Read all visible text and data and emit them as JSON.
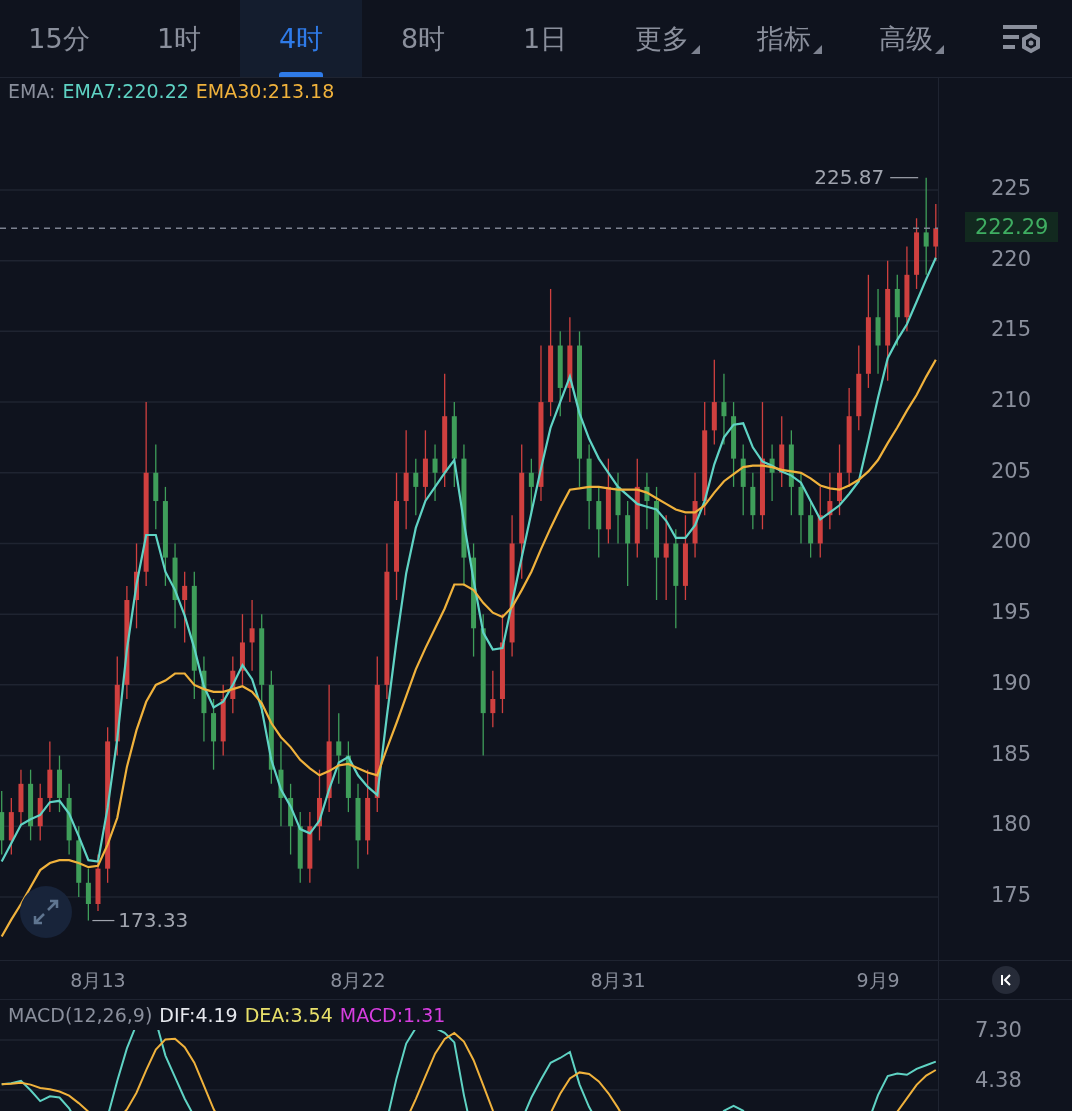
{
  "tabs": [
    {
      "label": "15分",
      "selected": false,
      "dropdown": false
    },
    {
      "label": "1时",
      "selected": false,
      "dropdown": false
    },
    {
      "label": "4时",
      "selected": true,
      "dropdown": false
    },
    {
      "label": "8时",
      "selected": false,
      "dropdown": false
    },
    {
      "label": "1日",
      "selected": false,
      "dropdown": false
    },
    {
      "label": "更多",
      "selected": false,
      "dropdown": true
    },
    {
      "label": "指标",
      "selected": false,
      "dropdown": true
    },
    {
      "label": "高级",
      "selected": false,
      "dropdown": true
    }
  ],
  "price_chart": {
    "legend_name": "EMA:",
    "legend": [
      ":220.22",
      ":213.18"
    ],
    "chart_data": {
      "type": "candlestick",
      "categories": [
        null,
        null,
        null,
        null,
        null,
        null,
        null,
        null,
        null,
        null,
        "8月13",
        null,
        null,
        null,
        null,
        null,
        null,
        null,
        null,
        null,
        null,
        null,
        null,
        null,
        null,
        null,
        null,
        null,
        null,
        null,
        null,
        null,
        null,
        null,
        null,
        null,
        null,
        "8月22",
        null,
        null,
        null,
        null,
        null,
        null,
        null,
        null,
        null,
        null,
        null,
        null,
        null,
        null,
        null,
        null,
        null,
        null,
        null,
        null,
        null,
        null,
        null,
        null,
        null,
        null,
        "8月31",
        null,
        null,
        null,
        null,
        null,
        null,
        null,
        null,
        null,
        null,
        null,
        null,
        null,
        null,
        null,
        null,
        null,
        null,
        null,
        null,
        null,
        null,
        null,
        null,
        null,
        null,
        "9月9",
        null,
        null,
        null,
        null,
        null,
        null
      ],
      "ohlc": [
        [
          181,
          182.5,
          178,
          179
        ],
        [
          179,
          182,
          178,
          181
        ],
        [
          181,
          184,
          180,
          183
        ],
        [
          183,
          184,
          179,
          180
        ],
        [
          180,
          183,
          179,
          182
        ],
        [
          182,
          186,
          181,
          184
        ],
        [
          184,
          185,
          181,
          182
        ],
        [
          182,
          183,
          178,
          179
        ],
        [
          179,
          180,
          175,
          176
        ],
        [
          176,
          177,
          173.33,
          174.5
        ],
        [
          174.5,
          178,
          174,
          177
        ],
        [
          177,
          187,
          176,
          186
        ],
        [
          186,
          192,
          185,
          190
        ],
        [
          190,
          197,
          189,
          196
        ],
        [
          196,
          200,
          194,
          198
        ],
        [
          198,
          210,
          197,
          205
        ],
        [
          205,
          207,
          201,
          203
        ],
        [
          203,
          204,
          197,
          199
        ],
        [
          199,
          200,
          194,
          196
        ],
        [
          196,
          198,
          193,
          197
        ],
        [
          197,
          198,
          189,
          191
        ],
        [
          191,
          192,
          186,
          188
        ],
        [
          188,
          189,
          184,
          186
        ],
        [
          186,
          190,
          185,
          189
        ],
        [
          189,
          192,
          188,
          191
        ],
        [
          191,
          195,
          190,
          193
        ],
        [
          193,
          196,
          191,
          194
        ],
        [
          194,
          195,
          188,
          190
        ],
        [
          190,
          191,
          183,
          184
        ],
        [
          184,
          186,
          180,
          182
        ],
        [
          182,
          183,
          178,
          180
        ],
        [
          180,
          181,
          176,
          177
        ],
        [
          177,
          181,
          176,
          180
        ],
        [
          180,
          184,
          179,
          182
        ],
        [
          182,
          190,
          181,
          186
        ],
        [
          186,
          188,
          183,
          185
        ],
        [
          185,
          186,
          181,
          182
        ],
        [
          182,
          183,
          177,
          179
        ],
        [
          179,
          184,
          178,
          182
        ],
        [
          182,
          192,
          181,
          190
        ],
        [
          190,
          200,
          189,
          198
        ],
        [
          198,
          205,
          196,
          203
        ],
        [
          203,
          208,
          201,
          205
        ],
        [
          205,
          206,
          202,
          204
        ],
        [
          204,
          208,
          203,
          206
        ],
        [
          206,
          207,
          203,
          205
        ],
        [
          205,
          212,
          204,
          209
        ],
        [
          209,
          210,
          204,
          206
        ],
        [
          206,
          207,
          197,
          199
        ],
        [
          199,
          200,
          192,
          194
        ],
        [
          194,
          195,
          185,
          188
        ],
        [
          188,
          191,
          187,
          189
        ],
        [
          189,
          195,
          188,
          193
        ],
        [
          193,
          202,
          192,
          200
        ],
        [
          200,
          207,
          197.5,
          205
        ],
        [
          205,
          206,
          202,
          204
        ],
        [
          204,
          214,
          203,
          210
        ],
        [
          210,
          218,
          209,
          214
        ],
        [
          214,
          215,
          209,
          211
        ],
        [
          211,
          216,
          210,
          214
        ],
        [
          214,
          215,
          204,
          206
        ],
        [
          206,
          207,
          201,
          203
        ],
        [
          203,
          204,
          199,
          201
        ],
        [
          201,
          206,
          200,
          204
        ],
        [
          204,
          205,
          200,
          202
        ],
        [
          202,
          203,
          197,
          200
        ],
        [
          200,
          206,
          199,
          204
        ],
        [
          204,
          205,
          201,
          203
        ],
        [
          203,
          204,
          196,
          199
        ],
        [
          199,
          202,
          196,
          200
        ],
        [
          200,
          201,
          194,
          197
        ],
        [
          197,
          202,
          196,
          200
        ],
        [
          200,
          205,
          199,
          203
        ],
        [
          203,
          210,
          202,
          208
        ],
        [
          208,
          213,
          207,
          210
        ],
        [
          210,
          212,
          207,
          209
        ],
        [
          209,
          210,
          204,
          206
        ],
        [
          206,
          207,
          202,
          204
        ],
        [
          204,
          205,
          201,
          202
        ],
        [
          202,
          210,
          201,
          206
        ],
        [
          206,
          207,
          203,
          205
        ],
        [
          205,
          209,
          204,
          207
        ],
        [
          207,
          208,
          202,
          204
        ],
        [
          204,
          205,
          200,
          202
        ],
        [
          202,
          203,
          199,
          200
        ],
        [
          200,
          204,
          199,
          202
        ],
        [
          202,
          205,
          201,
          203
        ],
        [
          203,
          207,
          202,
          205
        ],
        [
          205,
          211,
          204,
          209
        ],
        [
          209,
          214,
          208,
          212
        ],
        [
          212,
          219,
          211,
          216
        ],
        [
          216,
          218,
          212,
          214
        ],
        [
          214,
          220,
          211.5,
          218
        ],
        [
          218,
          219,
          214,
          216
        ],
        [
          216,
          221,
          215,
          219
        ],
        [
          219,
          223,
          218,
          222
        ],
        [
          222,
          225.87,
          219,
          221
        ],
        [
          221,
          224,
          220,
          222.29
        ]
      ],
      "grid": true,
      "series": [
        {
          "name": "EMA7",
          "type": "line",
          "color": "#5fd3c4",
          "values": [
            177.5,
            178.8,
            180.1,
            180.5,
            180.8,
            181.7,
            181.8,
            180.9,
            179.3,
            177.6,
            177.5,
            181.3,
            186.2,
            192.5,
            197.1,
            200.6,
            200.6,
            198.0,
            196.7,
            194.9,
            192.6,
            189.9,
            188.4,
            188.8,
            190.0,
            191.4,
            190.4,
            188.3,
            184.7,
            182.6,
            181.4,
            179.8,
            179.5,
            180.4,
            182.6,
            184.5,
            184.9,
            183.6,
            182.8,
            182.2,
            187.8,
            193.1,
            197.9,
            201.1,
            203.0,
            204.0,
            205.0,
            205.9,
            201.5,
            197.4,
            193.7,
            192.5,
            192.6,
            195.8,
            199.0,
            202.2,
            205.3,
            208.2,
            210.0,
            211.8,
            209.2,
            207.4,
            206.0,
            205.0,
            204.0,
            203.4,
            202.8,
            202.6,
            202.4,
            201.6,
            200.4,
            200.4,
            201.3,
            203.0,
            205.6,
            207.5,
            208.4,
            208.5,
            206.8,
            205.8,
            205.5,
            205.1,
            204.8,
            204.3,
            203.0,
            201.7,
            202.2,
            202.7,
            203.5,
            204.4,
            207.3,
            210.3,
            213.1,
            214.4,
            215.5,
            217.1,
            218.7,
            220.2
          ]
        },
        {
          "name": "EMA30",
          "type": "line",
          "color": "#f0b23c",
          "values": [
            172.2,
            173.4,
            174.5,
            175.7,
            176.9,
            177.4,
            177.6,
            177.6,
            177.4,
            177.1,
            177.2,
            178.7,
            180.6,
            184.2,
            186.8,
            188.8,
            190.0,
            190.3,
            190.8,
            190.8,
            190.0,
            189.7,
            189.5,
            189.5,
            189.7,
            189.9,
            189.5,
            188.7,
            187.3,
            186.3,
            185.6,
            184.7,
            184.1,
            183.6,
            183.9,
            184.3,
            184.4,
            184.1,
            183.8,
            183.6,
            185.5,
            187.3,
            189.2,
            191.1,
            192.6,
            194.0,
            195.4,
            197.1,
            197.1,
            196.7,
            195.8,
            195.1,
            194.8,
            195.5,
            196.7,
            198.0,
            199.6,
            201.1,
            202.5,
            203.8,
            203.9,
            204.0,
            204.0,
            203.9,
            203.8,
            203.8,
            203.8,
            203.6,
            203.2,
            202.8,
            202.4,
            202.2,
            202.2,
            202.7,
            203.6,
            204.4,
            204.9,
            205.4,
            205.5,
            205.5,
            205.4,
            205.2,
            205.1,
            205.0,
            204.6,
            204.1,
            203.9,
            203.8,
            204.1,
            204.5,
            205.1,
            205.9,
            207.1,
            208.2,
            209.4,
            210.5,
            211.8,
            213.0
          ]
        }
      ],
      "ylim": [
        170.54,
        232.92
      ],
      "yticks": [
        175,
        180,
        185,
        190,
        195,
        200,
        205,
        210,
        215,
        220,
        225
      ],
      "ref_lines": [
        {
          "axis": "y",
          "value": 222.29,
          "label": "222.29"
        }
      ],
      "annotations": [
        "225.87",
        "173.33"
      ]
    }
  },
  "macd": {
    "legend": [
      {
        "text": "MACD(12,26,9)",
        "color": "#8a8f9c"
      },
      {
        "text": "DIF:4.19",
        "color": "#e6e8ee"
      },
      {
        "text": "DEA:3.54",
        "color": "#e8e06a"
      },
      {
        "text": "MACD:1.31",
        "color": "#d63ee0"
      }
    ],
    "yticks": [
      "7.30",
      "4.38"
    ]
  }
}
